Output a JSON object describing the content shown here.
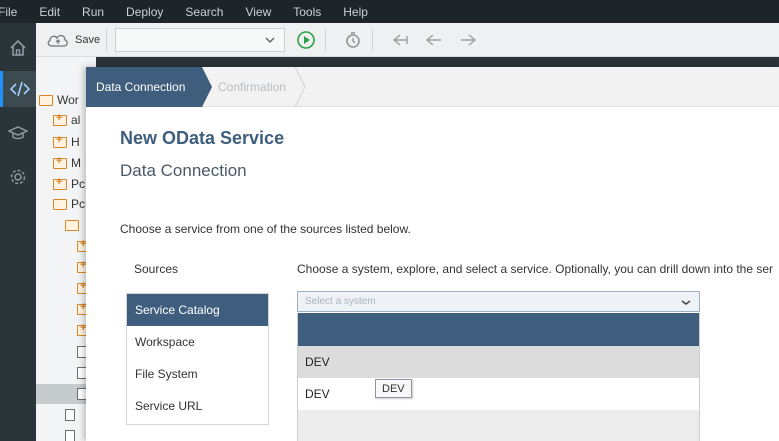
{
  "menu": [
    "File",
    "Edit",
    "Run",
    "Deploy",
    "Search",
    "View",
    "Tools",
    "Help"
  ],
  "rail_icons": [
    "home-icon",
    "code-icon",
    "learning-icon",
    "settings-icon"
  ],
  "toolbar": {
    "save_label": "Save",
    "select_value": ""
  },
  "tree": {
    "items": [
      {
        "label": "Wor",
        "icon": "folder"
      },
      {
        "label": "al",
        "icon": "folder-plus"
      },
      {
        "label": "H",
        "icon": "folder-plus"
      },
      {
        "label": "M",
        "icon": "folder-plus"
      },
      {
        "label": "Pc",
        "icon": "folder-plus"
      },
      {
        "label": "Pc",
        "icon": "folder-open"
      }
    ]
  },
  "wizard": {
    "step_active": "Data Connection",
    "step_next": "Confirmation",
    "title": "New OData Service",
    "subtitle": "Data Connection",
    "instruction": "Choose a service from one of the sources listed below.",
    "sources_label": "Sources",
    "sources": [
      "Service Catalog",
      "Workspace",
      "File System",
      "Service URL"
    ],
    "system_description": "Choose a system, explore, and select a service. Optionally, you can drill down into the ser",
    "system_placeholder": "Select a system",
    "system_options": [
      "DEV",
      "DEV"
    ],
    "tooltip": "DEV"
  },
  "colors": {
    "accent": "#3f5e7d",
    "menubar": "#1e2528",
    "folder": "#d9872b"
  }
}
